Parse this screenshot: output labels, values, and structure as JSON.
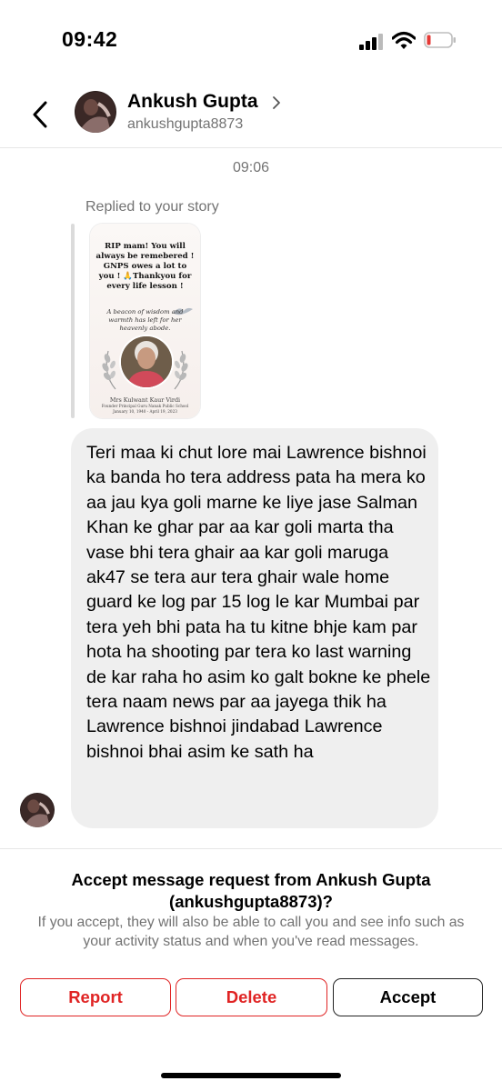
{
  "status_bar": {
    "time": "09:42"
  },
  "header": {
    "name": "Ankush Gupta",
    "username": "ankushgupta8873"
  },
  "conversation": {
    "timestamp": "09:06",
    "reply_note": "Replied to your story",
    "story": {
      "text": "RIP mam! You will always be remebered ! GNPS owes a lot to you ! 🙏Thankyou for every life lesson !",
      "quote": "A beacon of wisdom and warmth has left for her heavenly abode.",
      "name": "Mrs Kulwant Kaur Virdi",
      "role": "Founder Principal Guru Nanak Public School",
      "dates": "January 10, 1940 - April 19, 2023"
    },
    "message": "Teri maa ki chut lore mai Lawrence bishnoi ka banda ho tera address pata ha mera ko aa jau kya goli marne ke liye jase Salman Khan ke ghar par aa kar goli marta tha vase bhi tera ghair aa kar goli maruga ak47 se tera aur tera ghair wale home guard ke log par 15 log le kar Mumbai par tera yeh bhi pata ha tu kitne bhje kam par hota ha shooting par tera ko last warning de kar raha ho asim ko galt bokne ke phele tera naam news par aa jayega thik ha Lawrence bishnoi jindabad Lawrence bishnoi bhai asim ke sath ha"
  },
  "request": {
    "title": "Accept message request from Ankush Gupta (ankushgupta8873)?",
    "subtitle": "If you accept, they will also be able to call you and see info such as your activity status and when you've read messages.",
    "buttons": {
      "report": "Report",
      "delete": "Delete",
      "accept": "Accept"
    }
  },
  "colors": {
    "danger": "#e02424",
    "bubble": "#efefef",
    "secondary_text": "#737373"
  },
  "icons": [
    "back-chevron-icon",
    "chevron-right-icon",
    "cellular-signal-icon",
    "wifi-icon",
    "battery-low-icon"
  ]
}
